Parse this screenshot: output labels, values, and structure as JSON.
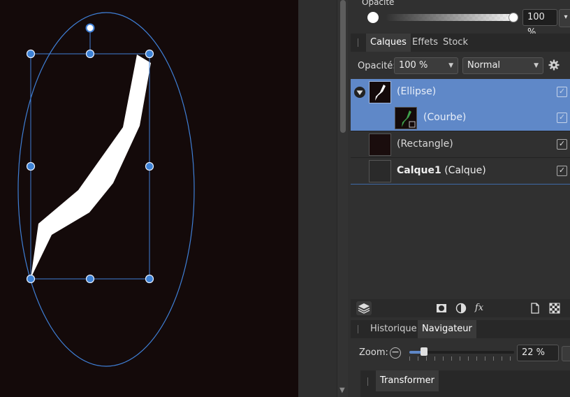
{
  "top": {
    "opacity_label": "Opacité",
    "opacity_value": "100 %",
    "opacity_level": 1.0
  },
  "layers_panel": {
    "tabs": [
      {
        "label": "Calques",
        "active": true
      },
      {
        "label": "Effets",
        "active": false
      },
      {
        "label": "Stock",
        "active": false
      }
    ],
    "opacity_label": "Opacité:",
    "opacity_value": "100 %",
    "blend_mode": "Normal",
    "layers": [
      {
        "name": "(Ellipse)",
        "selected": true,
        "visible": true
      },
      {
        "name": "(Courbe)",
        "selected": true,
        "visible": true,
        "child": true
      },
      {
        "name": "(Rectangle)",
        "selected": false,
        "visible": true
      },
      {
        "name_bold": "Calque1",
        "name": "(Calque)",
        "selected": false,
        "visible": true
      }
    ]
  },
  "navigator_panel": {
    "tabs": [
      {
        "label": "Historique",
        "active": false
      },
      {
        "label": "Navigateur",
        "active": true
      }
    ],
    "zoom_label": "Zoom:",
    "zoom_value": "22 %",
    "zoom_level": 0.22
  },
  "transform_panel": {
    "tab_label": "Transformer"
  },
  "colors": {
    "selection": "#5f88c8",
    "canvas_bg": "#140a0a",
    "handle": "#3d82d6",
    "panel_bg": "#303030"
  },
  "icons": [
    "layers-stack-icon",
    "mask-icon",
    "adjustment-icon",
    "fx-icon",
    "new-document-icon",
    "checkerboard-icon",
    "settings-gear-icon",
    "collapse-triangle-icon"
  ]
}
